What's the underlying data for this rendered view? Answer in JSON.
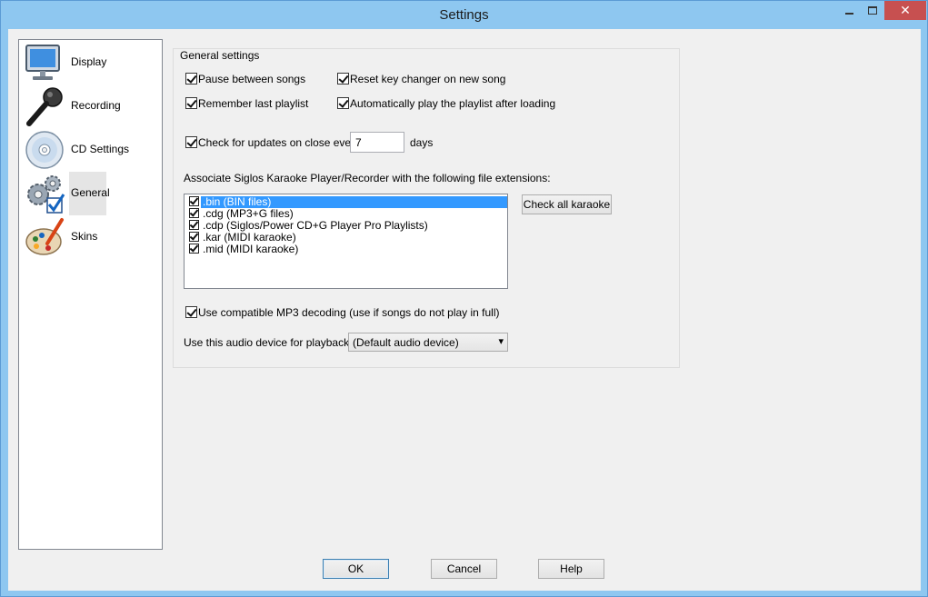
{
  "window": {
    "title": "Settings"
  },
  "sidebar": {
    "items": [
      {
        "label": "Display",
        "icon": "monitor-icon"
      },
      {
        "label": "Recording",
        "icon": "microphone-icon"
      },
      {
        "label": "CD Settings",
        "icon": "cd-icon"
      },
      {
        "label": "General",
        "icon": "gears-check-icon",
        "selected": true
      },
      {
        "label": "Skins",
        "icon": "palette-icon"
      }
    ]
  },
  "general": {
    "group_title": "General settings",
    "pause_between_songs": {
      "label": "Pause between songs",
      "checked": true
    },
    "reset_key_changer": {
      "label": "Reset key changer on new song",
      "checked": true
    },
    "remember_playlist": {
      "label": "Remember last playlist",
      "checked": true
    },
    "auto_play_playlist": {
      "label": "Automatically play the playlist after loading",
      "checked": true
    },
    "check_updates": {
      "label": "Check for updates on close every",
      "checked": true,
      "value": "7",
      "suffix": "days"
    },
    "associate_label": "Associate Siglos Karaoke Player/Recorder with the following file extensions:",
    "extensions": [
      {
        "label": ".bin (BIN files)",
        "checked": true,
        "selected": true
      },
      {
        "label": ".cdg (MP3+G files)",
        "checked": true
      },
      {
        "label": ".cdp (Siglos/Power CD+G Player Pro Playlists)",
        "checked": true
      },
      {
        "label": ".kar (MIDI karaoke)",
        "checked": true
      },
      {
        "label": ".mid (MIDI karaoke)",
        "checked": true
      }
    ],
    "check_all_label": "Check all karaoke",
    "compatible_mp3": {
      "label": "Use compatible MP3 decoding (use if songs do not play in full)",
      "checked": true
    },
    "audio_device_label": "Use this audio device for playback:",
    "audio_device_value": "(Default audio device)"
  },
  "buttons": {
    "ok": "OK",
    "cancel": "Cancel",
    "help": "Help"
  },
  "colors": {
    "titlebar": "#8ec7f0",
    "close_button": "#c75050",
    "selection": "#3399ff"
  }
}
